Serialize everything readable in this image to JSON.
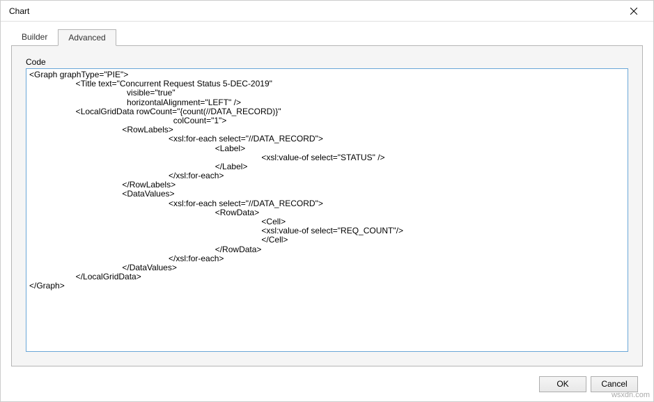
{
  "dialog": {
    "title": "Chart"
  },
  "tabs": {
    "builder": "Builder",
    "advanced": "Advanced"
  },
  "panel": {
    "code_label": "Code",
    "code_value": "<Graph graphType=\"PIE\">\n                    <Title text=\"Concurrent Request Status 5-DEC-2019\"\n                                          visible=\"true\"\n                                          horizontalAlignment=\"LEFT\" />\n                    <LocalGridData rowCount=\"{count(//DATA_RECORD)}\"\n                                                              colCount=\"1\">\n                                        <RowLabels>\n                                                            <xsl:for-each select=\"//DATA_RECORD\">\n                                                                                <Label>\n                                                                                                    <xsl:value-of select=\"STATUS\" />\n                                                                                </Label>\n                                                            </xsl:for-each>\n                                        </RowLabels>\n                                        <DataValues>\n                                                            <xsl:for-each select=\"//DATA_RECORD\">\n                                                                                <RowData>\n                                                                                                    <Cell>\n                                                                                                    <xsl:value-of select=\"REQ_COUNT\"/>\n                                                                                                    </Cell>\n                                                                                </RowData>\n                                                            </xsl:for-each>\n                                        </DataValues>\n                    </LocalGridData>\n</Graph>"
  },
  "buttons": {
    "ok": "OK",
    "cancel": "Cancel"
  },
  "watermark": "wsxdn.com"
}
